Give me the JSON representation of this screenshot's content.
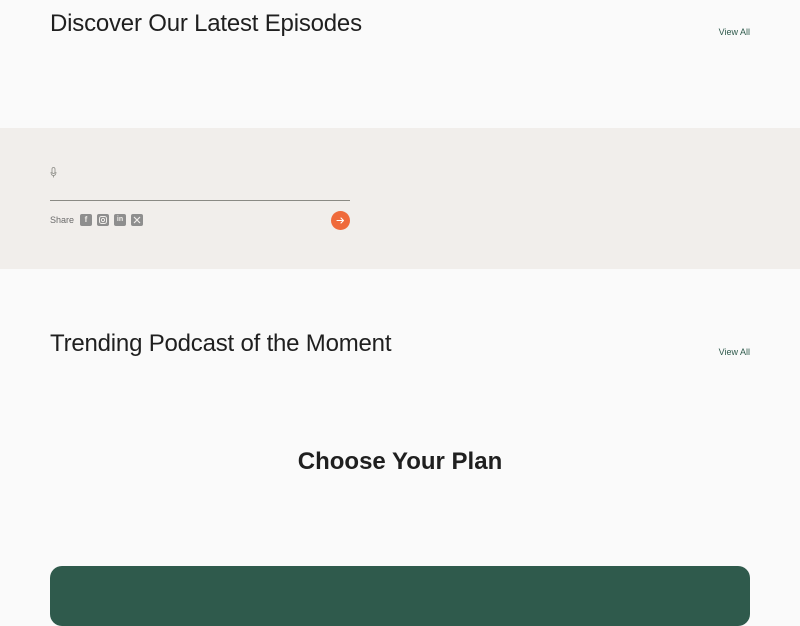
{
  "episodes": {
    "title": "Discover Our Latest Episodes",
    "view_all": "View All"
  },
  "player": {
    "mic_icon": "microphone-icon",
    "share_label": "Share",
    "social_icons": [
      "facebook-icon",
      "instagram-icon",
      "linkedin-icon",
      "x-icon"
    ],
    "play_icon": "arrow-right-icon"
  },
  "trending": {
    "title": "Trending Podcast of the Moment",
    "view_all": "View All"
  },
  "plans": {
    "title": "Choose Your Plan"
  },
  "colors": {
    "accent": "#ef6a3b",
    "brand_green": "#2f5a4c",
    "band_bg": "#f1eeeb",
    "page_bg": "#fafafa"
  }
}
